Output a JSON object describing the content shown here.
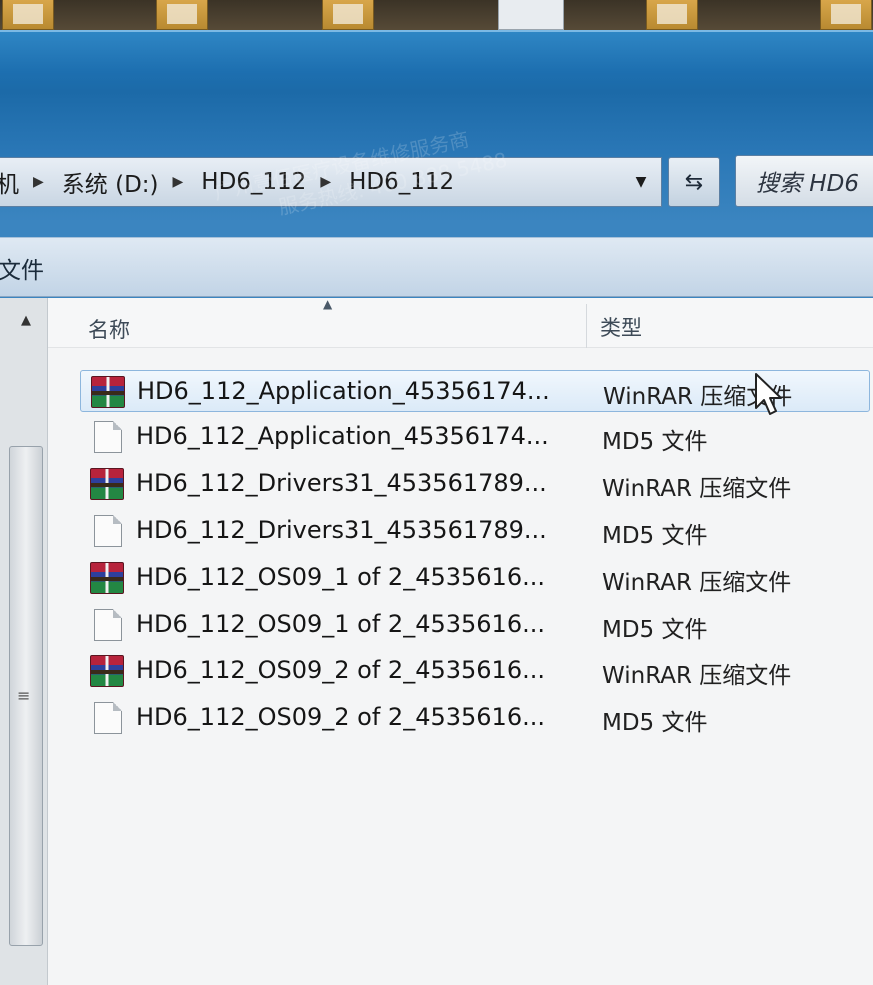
{
  "breadcrumb": {
    "items": [
      "机",
      "系统 (D:)",
      "HD6_112",
      "HD6_112"
    ]
  },
  "search": {
    "placeholder": "搜索 HD6"
  },
  "toolbar": {
    "label": "文件"
  },
  "columns": {
    "name": "名称",
    "type": "类型"
  },
  "files": [
    {
      "name": "HD6_112_Application_45356174...",
      "type": "WinRAR 压缩文件",
      "icon": "winrar-archive-icon"
    },
    {
      "name": "HD6_112_Application_45356174...",
      "type": "MD5 文件",
      "icon": "blank-file-icon"
    },
    {
      "name": "HD6_112_Drivers31_453561789...",
      "type": "WinRAR 压缩文件",
      "icon": "winrar-archive-icon"
    },
    {
      "name": "HD6_112_Drivers31_453561789...",
      "type": "MD5 文件",
      "icon": "blank-file-icon"
    },
    {
      "name": "HD6_112_OS09_1 of 2_4535616...",
      "type": "WinRAR 压缩文件",
      "icon": "winrar-archive-icon"
    },
    {
      "name": "HD6_112_OS09_1 of 2_4535616...",
      "type": "MD5 文件",
      "icon": "blank-file-icon"
    },
    {
      "name": "HD6_112_OS09_2 of 2_4535616...",
      "type": "WinRAR 压缩文件",
      "icon": "winrar-archive-icon"
    },
    {
      "name": "HD6_112_OS09_2 of 2_4535616...",
      "type": "MD5 文件",
      "icon": "blank-file-icon"
    }
  ],
  "watermark": {
    "line1": "广州壹佰医疗设备维修服务商",
    "line2": "服务热线: 400 888 5488"
  },
  "icons": {
    "dropdown": "chevron-down-icon",
    "refresh": "refresh-icon",
    "scroll_up": "scroll-up-arrow-icon",
    "sort": "sort-ascending-icon",
    "cursor": "mouse-pointer-icon"
  },
  "colors": {
    "window_frame": "#1d6fb0",
    "selection": "#dbeaf8",
    "winrar_red": "#b7233c",
    "winrar_blue": "#2e3f9c",
    "winrar_green": "#238743"
  }
}
